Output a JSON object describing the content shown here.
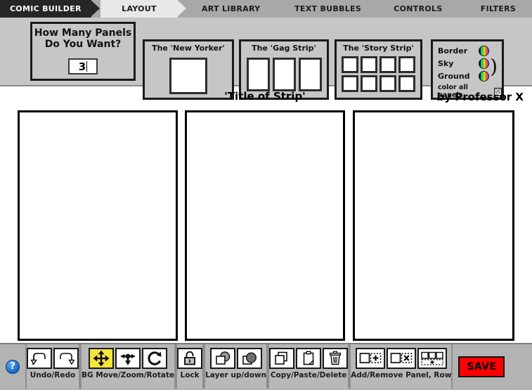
{
  "app": {
    "brand": "COMIC BUILDER"
  },
  "tabs": [
    {
      "label": "LAYOUT",
      "active": true
    },
    {
      "label": "ART LIBRARY",
      "active": false
    },
    {
      "label": "TEXT BUBBLES",
      "active": false
    },
    {
      "label": "CONTROLS",
      "active": false
    },
    {
      "label": "FILTERS",
      "active": false
    }
  ],
  "layout_options": {
    "panel_count": {
      "title_line1": "How Many Panels",
      "title_line2": "Do You Want?",
      "value": "3"
    },
    "presets": [
      {
        "name": "new-yorker",
        "title": "The 'New Yorker'",
        "panels": 1
      },
      {
        "name": "gag-strip",
        "title": "The 'Gag Strip'",
        "panels": 3
      },
      {
        "name": "story-strip",
        "title": "The 'Story Strip'",
        "panels": 8
      }
    ],
    "colors": {
      "rows": [
        {
          "label": "Border",
          "icon": "color-wheel-icon"
        },
        {
          "label": "Sky",
          "icon": "color-wheel-icon"
        },
        {
          "label": "Ground",
          "icon": "color-wheel-icon"
        }
      ],
      "all_panels_label": "color all panels",
      "all_panels_checked": "☒"
    }
  },
  "strip": {
    "title": "'Title of Strip'",
    "byline": "by Professor X",
    "panel_count": 3
  },
  "toolbar": {
    "help_label": "?",
    "groups": [
      {
        "name": "undo-redo",
        "label": "Undo/Redo",
        "buttons": [
          {
            "name": "undo-button",
            "icon": "undo-arrow-icon",
            "active": false
          },
          {
            "name": "redo-button",
            "icon": "redo-arrow-icon",
            "active": false
          }
        ]
      },
      {
        "name": "bg-transform",
        "label": "BG Move/Zoom/Rotate",
        "buttons": [
          {
            "name": "bg-move-button",
            "icon": "move-four-arrows-icon",
            "active": true
          },
          {
            "name": "bg-zoom-button",
            "icon": "zoom-arrows-icon",
            "active": false
          },
          {
            "name": "bg-rotate-button",
            "icon": "rotate-icon",
            "active": false
          }
        ]
      },
      {
        "name": "lock",
        "label": "Lock",
        "buttons": [
          {
            "name": "lock-button",
            "icon": "padlock-icon",
            "active": false
          }
        ]
      },
      {
        "name": "layer",
        "label": "Layer up/down",
        "buttons": [
          {
            "name": "layer-up-button",
            "icon": "layer-up-icon",
            "active": false
          },
          {
            "name": "layer-down-button",
            "icon": "layer-down-icon",
            "active": false
          }
        ]
      },
      {
        "name": "clipboard",
        "label": "Copy/Paste/Delete",
        "buttons": [
          {
            "name": "copy-button",
            "icon": "copy-icon",
            "active": false
          },
          {
            "name": "paste-button",
            "icon": "clipboard-icon",
            "active": false
          },
          {
            "name": "delete-button",
            "icon": "trash-icon",
            "active": false
          }
        ]
      },
      {
        "name": "panel-row",
        "label": "Add/Remove Panel, Row",
        "buttons": [
          {
            "name": "add-panel-button",
            "icon": "add-panel-icon",
            "active": false
          },
          {
            "name": "remove-panel-button",
            "icon": "remove-panel-icon",
            "active": false
          },
          {
            "name": "add-row-button",
            "icon": "add-row-icon",
            "active": false
          }
        ]
      }
    ],
    "save_label": "SAVE"
  },
  "colors": {
    "brand_tab_bg": "#262626",
    "active_tab_bg": "#e8e8e8",
    "idle_tab_bg": "#a8a8a8",
    "panel_bg": "#c6c6c6",
    "toolbar_bg": "#b3b3b3",
    "active_tool": "#f5e63c",
    "save_red": "#ff0000",
    "help_blue": "#1667c8"
  }
}
